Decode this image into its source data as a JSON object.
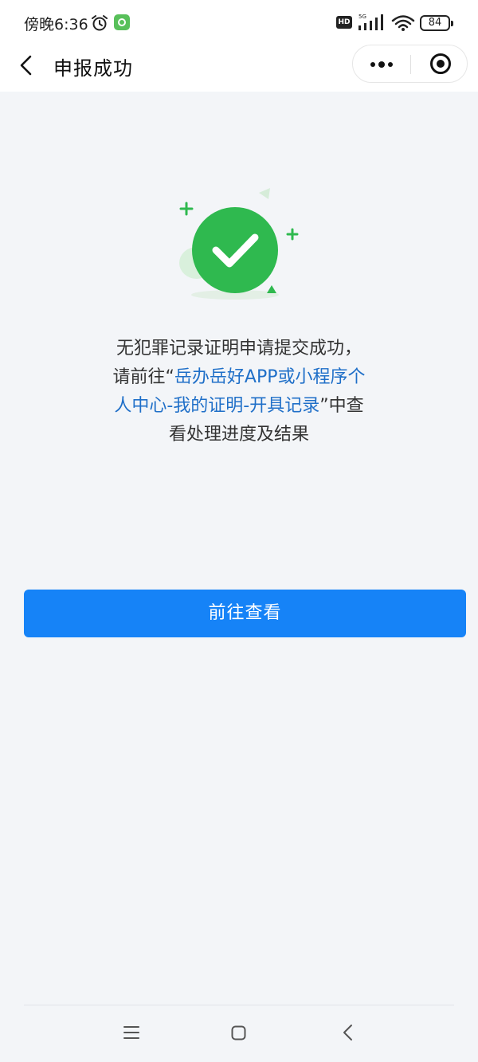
{
  "status_bar": {
    "time": "傍晚6:36",
    "hd_label": "HD",
    "network": "5G",
    "battery": "84",
    "icons": [
      "alarm-icon",
      "app-badge-icon",
      "signal-icon",
      "wifi-icon",
      "battery-icon"
    ]
  },
  "nav": {
    "title": "申报成功",
    "icons": [
      "back-icon",
      "more-icon",
      "close-target-icon"
    ]
  },
  "message": {
    "part1": "无犯罪记录证明申请提交成功，请前往“",
    "highlight": "岳办岳好APP或小程序个人中心-我的证明-开具记录",
    "part2": "”中查看处理进度及结果"
  },
  "primary_button": {
    "label": "前往查看"
  },
  "colors": {
    "accent": "#1683f7",
    "link": "#1f6fc8",
    "success": "#2fb94f",
    "background": "#f3f5f8"
  },
  "system_nav": {
    "icons": [
      "menu-icon",
      "home-icon",
      "back-icon"
    ]
  }
}
